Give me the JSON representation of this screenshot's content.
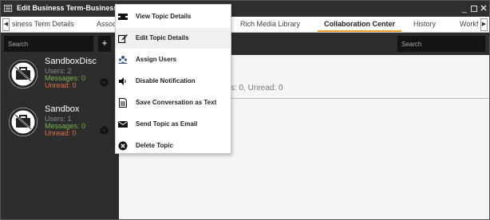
{
  "window": {
    "title": "Edit Business Term-Business_Term"
  },
  "tabs": [
    {
      "label": "siness Term Details"
    },
    {
      "label": "Assoc"
    },
    {
      "label": "Rich Media Library"
    },
    {
      "label": "Collaboration Center"
    },
    {
      "label": "History"
    },
    {
      "label": "Workf"
    }
  ],
  "active_tab": "Collaboration Center",
  "sidebar": {
    "search_placeholder": "Search",
    "add_label": "+",
    "topics": [
      {
        "name": "SandboxDisc",
        "users": "Users: 2",
        "messages": "Messages: 0",
        "unread": "Unread: 0"
      },
      {
        "name": "Sandbox",
        "users": "Users: 1",
        "messages": "Messages: 0",
        "unread": "Unread: 0"
      }
    ]
  },
  "main": {
    "search_placeholder": "Search",
    "summary": "s: 0, Unread: 0"
  },
  "context_menu": {
    "items": [
      {
        "label": "View Topic Details",
        "icon": "view-details-icon"
      },
      {
        "label": "Edit Topic Details",
        "icon": "edit-icon"
      },
      {
        "label": "Assign Users",
        "icon": "users-icon"
      },
      {
        "label": "Disable Notification",
        "icon": "speaker-icon"
      },
      {
        "label": "Save Conversation as Text",
        "icon": "document-icon"
      },
      {
        "label": "Send Topic as Email",
        "icon": "envelope-icon"
      },
      {
        "label": "Delete Topic",
        "icon": "delete-icon"
      }
    ]
  },
  "colors": {
    "accent": "#f0a030",
    "messages": "#7bb34b",
    "unread": "#e0704a",
    "dark_panel": "#2d2d2d"
  }
}
